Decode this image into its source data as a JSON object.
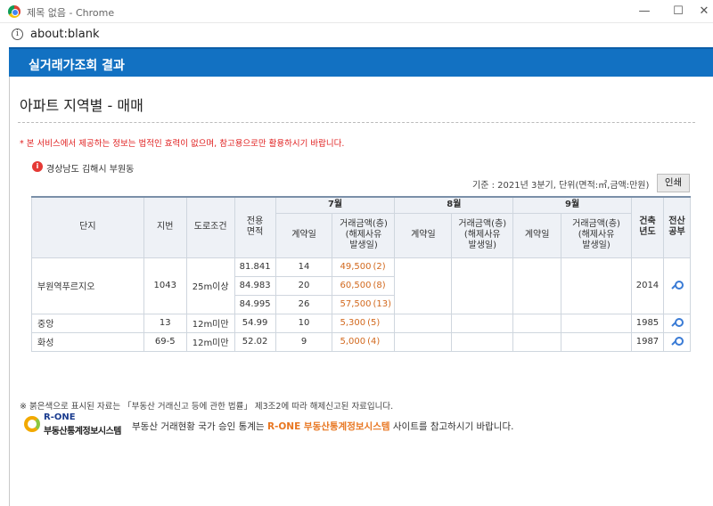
{
  "window": {
    "title": "제목 없음 - Chrome",
    "minimize": "—",
    "maximize": "☐",
    "close": "✕"
  },
  "address": {
    "url": "about:blank",
    "info_icon": "info-icon"
  },
  "header": {
    "title": "실거래가조회 결과"
  },
  "section": {
    "title": "아파트 지역별 - 매매"
  },
  "notice": "* 본 서비스에서 제공하는 정보는 법적인 효력이 없으며, 참고용으로만 활용하시기 바랍니다.",
  "region": "경상남도 김해시 부원동",
  "basis": "기준 : 2021년 3분기, 단위(면적:㎡,금액:만원)",
  "print_label": "인쇄",
  "table": {
    "headers": {
      "complex": "단지",
      "lot": "지번",
      "road": "도로조건",
      "area": "전용\n면적",
      "months": [
        "7월",
        "8월",
        "9월"
      ],
      "contract_day": "계약일",
      "amount": "거래금액(층)\n(해제사유\n발생일)",
      "built": "건축\n년도",
      "registry": "전산\n공부"
    },
    "rows": [
      {
        "complex": "부원역푸르지오",
        "lot": "1043",
        "road": "25m이상",
        "built": "2014",
        "entries": [
          {
            "area": "81.841",
            "day": "14",
            "amount": "49,500",
            "floor": "(2)"
          },
          {
            "area": "84.983",
            "day": "20",
            "amount": "60,500",
            "floor": "(8)"
          },
          {
            "area": "84.995",
            "day": "26",
            "amount": "57,500",
            "floor": "(13)"
          }
        ]
      },
      {
        "complex": "중앙",
        "lot": "13",
        "road": "12m미만",
        "built": "1985",
        "entries": [
          {
            "area": "54.99",
            "day": "10",
            "amount": "5,300",
            "floor": "(5)"
          }
        ]
      },
      {
        "complex": "화성",
        "lot": "69-5",
        "road": "12m미만",
        "built": "1987",
        "entries": [
          {
            "area": "52.02",
            "day": "9",
            "amount": "5,000",
            "floor": "(4)"
          }
        ]
      }
    ]
  },
  "footnote": "※ 붉은색으로 표시된 자료는 「부동산 거래신고 등에 관한 법률」 제3조2에 따라 해제신고된 자료입니다.",
  "rone": {
    "logo_name": "R-ONE",
    "logo_sub": "부동산통계정보시스템",
    "text_before": "부동산 거래현황 국가 승인 통계는",
    "text_highlight": "R-ONE 부동산통계정보시스템",
    "text_after": "사이트를 참고하시기 바랍니다."
  },
  "colors": {
    "header_bg": "#1271c2",
    "amount": "#d2691e",
    "notice": "#e02020"
  }
}
